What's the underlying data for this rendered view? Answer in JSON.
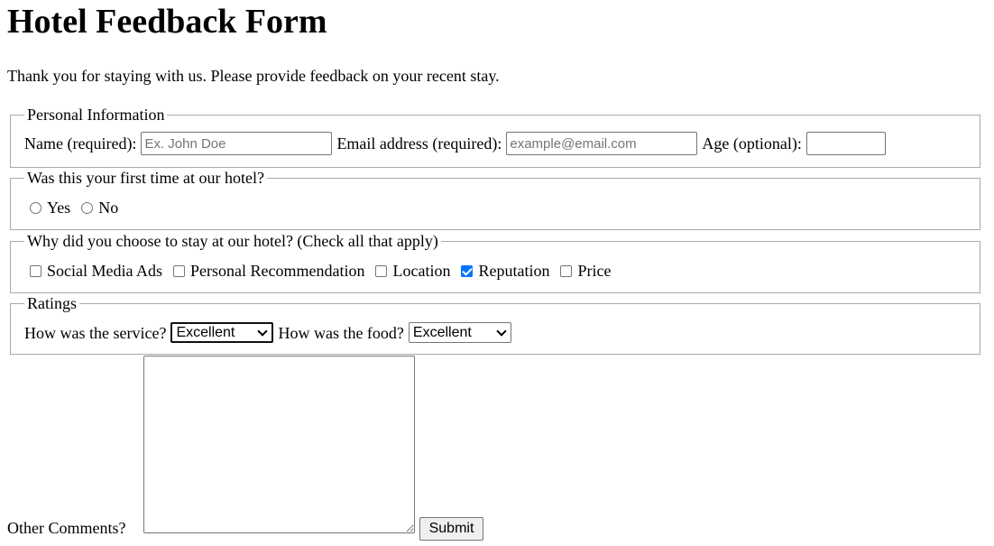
{
  "title": "Hotel Feedback Form",
  "intro": "Thank you for staying with us. Please provide feedback on your recent stay.",
  "personal": {
    "legend": "Personal Information",
    "name_label": "Name (required):",
    "name_placeholder": "Ex. John Doe",
    "name_value": "",
    "email_label": "Email address (required):",
    "email_placeholder": "example@email.com",
    "email_value": "",
    "age_label": "Age (optional):",
    "age_value": ""
  },
  "first_time": {
    "legend": "Was this your first time at our hotel?",
    "options": [
      {
        "label": "Yes",
        "selected": false
      },
      {
        "label": "No",
        "selected": false
      }
    ]
  },
  "reasons": {
    "legend": "Why did you choose to stay at our hotel? (Check all that apply)",
    "options": [
      {
        "label": "Social Media Ads",
        "checked": false
      },
      {
        "label": "Personal Recommendation",
        "checked": false
      },
      {
        "label": "Location",
        "checked": false
      },
      {
        "label": "Reputation",
        "checked": true
      },
      {
        "label": "Price",
        "checked": false
      }
    ]
  },
  "ratings": {
    "legend": "Ratings",
    "service_label": "How was the service?",
    "service_value": "Excellent",
    "food_label": "How was the food?",
    "food_value": "Excellent"
  },
  "comments": {
    "label": "Other Comments?",
    "value": ""
  },
  "submit_label": "Submit",
  "colors": {
    "checkbox_checked": "#0075ff",
    "border": "#a9a9a9"
  }
}
